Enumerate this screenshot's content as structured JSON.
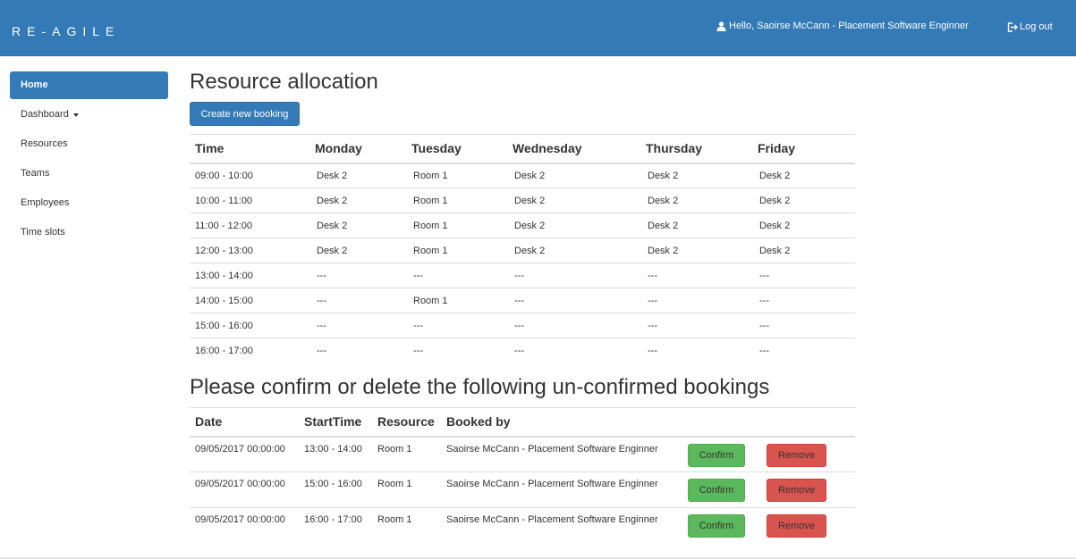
{
  "navbar": {
    "brand": "RE-AGILE",
    "user_greeting": "Hello, Saoirse McCann - Placement Software Enginner",
    "logout_label": "Log out",
    "user_icon": "user-icon",
    "logout_icon": "logout-icon",
    "color": "#337ab7"
  },
  "sidebar": {
    "items": [
      {
        "label": "Home",
        "active": true
      },
      {
        "label": "Dashboard",
        "dropdown": true
      },
      {
        "label": "Resources"
      },
      {
        "label": "Teams"
      },
      {
        "label": "Employees"
      },
      {
        "label": "Time slots"
      }
    ]
  },
  "main": {
    "title": "Resource allocation",
    "create_button": "Create new booking",
    "allocation_table": {
      "headers": [
        "Time",
        "Monday",
        "Tuesday",
        "Wednesday",
        "Thursday",
        "Friday"
      ],
      "rows": [
        [
          "09:00 - 10:00",
          "Desk 2",
          "Room 1",
          "Desk 2",
          "Desk 2",
          "Desk 2"
        ],
        [
          "10:00 - 11:00",
          "Desk 2",
          "Room 1",
          "Desk 2",
          "Desk 2",
          "Desk 2"
        ],
        [
          "11:00 - 12:00",
          "Desk 2",
          "Room 1",
          "Desk 2",
          "Desk 2",
          "Desk 2"
        ],
        [
          "12:00 - 13:00",
          "Desk 2",
          "Room 1",
          "Desk 2",
          "Desk 2",
          "Desk 2"
        ],
        [
          "13:00 - 14:00",
          "---",
          "---",
          "---",
          "---",
          "---"
        ],
        [
          "14:00 - 15:00",
          "---",
          "Room 1",
          "---",
          "---",
          "---"
        ],
        [
          "15:00 - 16:00",
          "---",
          "---",
          "---",
          "---",
          "---"
        ],
        [
          "16:00 - 17:00",
          "---",
          "---",
          "---",
          "---",
          "---"
        ]
      ]
    },
    "pending_title": "Please confirm or delete the following un-confirmed bookings",
    "pending_table": {
      "headers": [
        "Date",
        "StartTime",
        "Resource",
        "Booked by"
      ],
      "confirm_label": "Confirm",
      "remove_label": "Remove",
      "rows": [
        [
          "09/05/2017 00:00:00",
          "13:00 - 14:00",
          "Room 1",
          "Saoirse McCann - Placement Software Enginner"
        ],
        [
          "09/05/2017 00:00:00",
          "15:00 - 16:00",
          "Room 1",
          "Saoirse McCann - Placement Software Enginner"
        ],
        [
          "09/05/2017 00:00:00",
          "16:00 - 17:00",
          "Room 1",
          "Saoirse McCann - Placement Software Enginner"
        ]
      ]
    }
  },
  "colors": {
    "primary": "#337ab7",
    "success": "#5cb85c",
    "danger": "#d9534f"
  }
}
